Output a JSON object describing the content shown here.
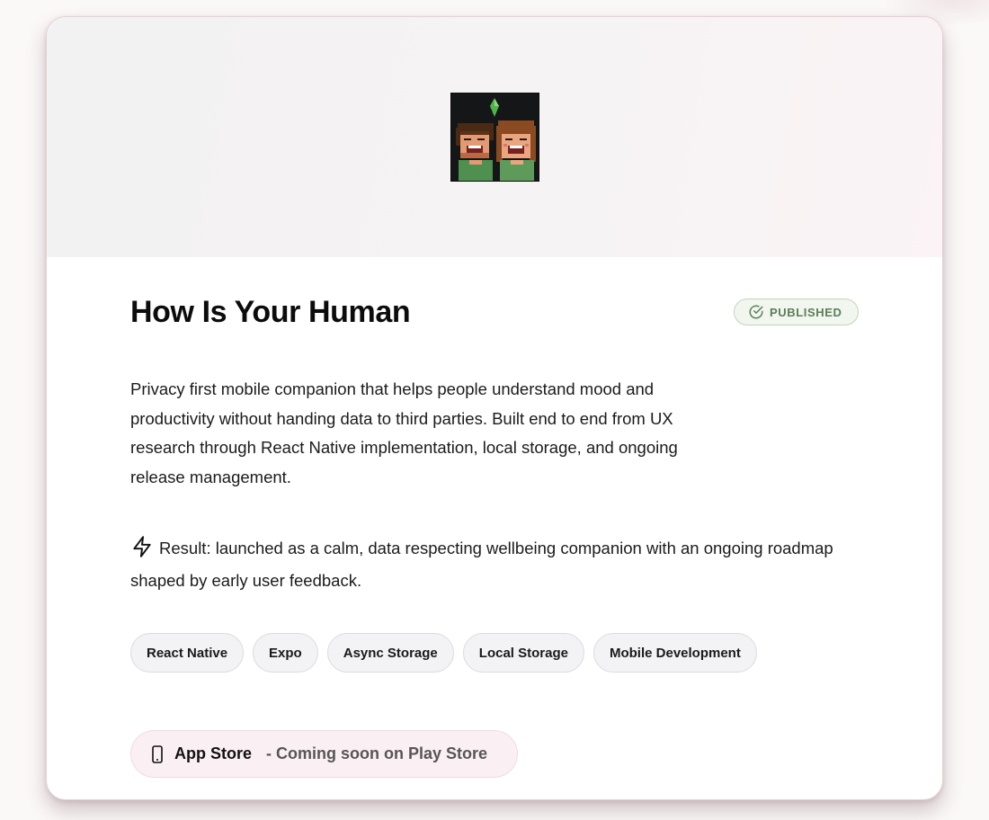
{
  "project": {
    "title": "How Is Your Human",
    "status_badge": "PUBLISHED",
    "description": "Privacy first mobile companion that helps people understand mood and productivity without handing data to third parties. Built end to end from UX research through React Native implementation, local storage, and ongoing release management.",
    "result": "Result: launched as a calm, data respecting wellbeing companion with an ongoing roadmap shaped by early user feedback.",
    "tags": [
      "React Native",
      "Expo",
      "Async Storage",
      "Local Storage",
      "Mobile Development"
    ],
    "store": {
      "name": "App Store",
      "note": "- Coming soon on Play Store"
    }
  },
  "icons": {
    "badge": "check-circle-icon",
    "result": "lightning-icon",
    "store": "phone-icon",
    "hero": "pixel-couple-avatar"
  },
  "colors": {
    "badge_text": "#5b7e58",
    "badge_border": "#bfd6bd",
    "store_pill_bg": "#faf0f3",
    "gem": "#4fb34a"
  }
}
